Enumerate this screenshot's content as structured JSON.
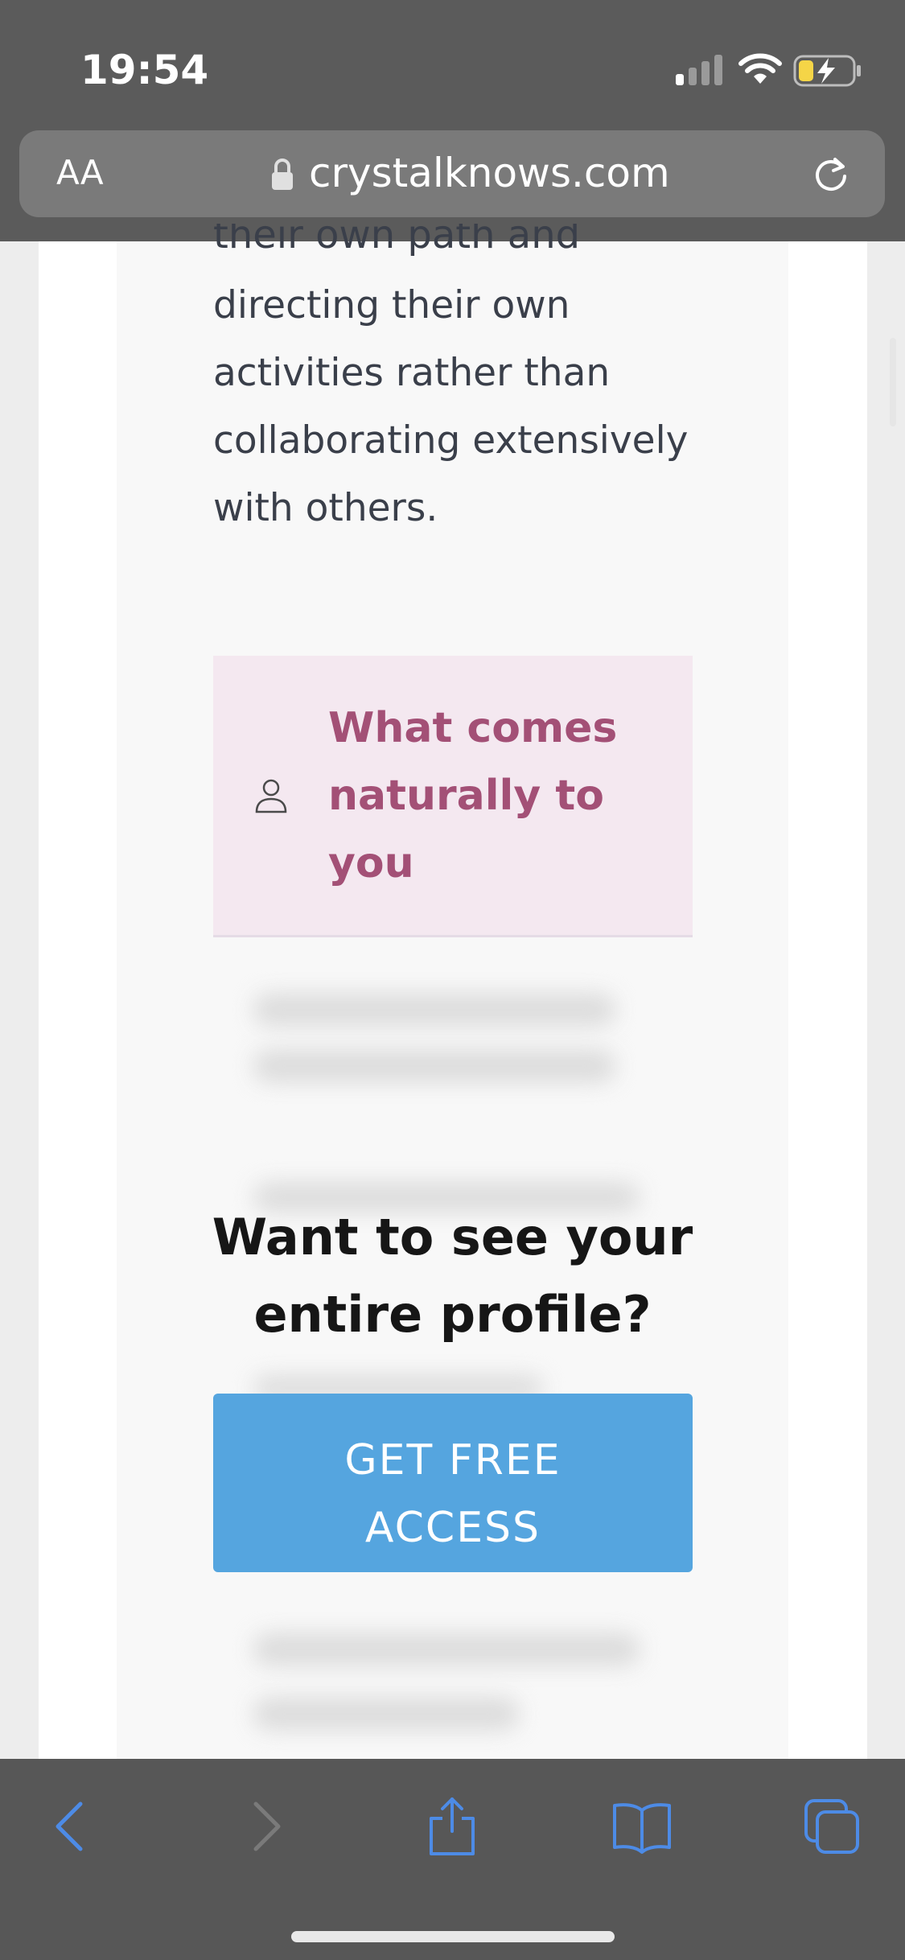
{
  "status_bar": {
    "time": "19:54"
  },
  "browser": {
    "text_size_button": "AA",
    "url": "crystalknows.com"
  },
  "content": {
    "cut_off_text": "their own path and",
    "paragraph": "directing their own activities rather than collaborating extensively with others.",
    "natural_box": {
      "title": "What comes naturally to you",
      "icon": "person-icon"
    },
    "cta": {
      "title": "Want to see your entire profile?",
      "button": "GET FREE ACCESS"
    }
  },
  "toolbar": {
    "icons": [
      "back-icon",
      "forward-icon",
      "share-icon",
      "bookmarks-icon",
      "tabs-icon"
    ]
  },
  "colors": {
    "accent_blue": "#55a5df",
    "accent_pink": "#a35076",
    "box_bg": "#f4e8f0",
    "chrome": "#5b5b5b"
  }
}
